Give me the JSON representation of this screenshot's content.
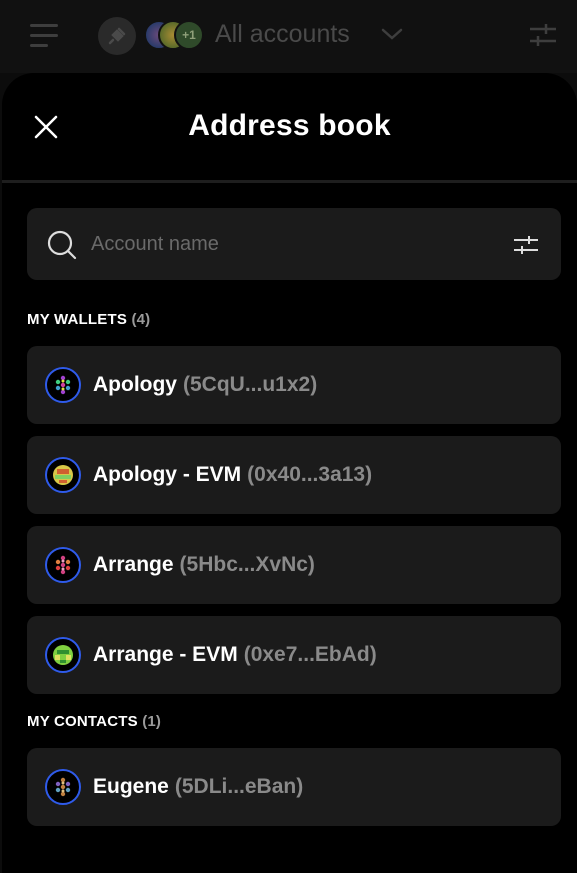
{
  "topbar": {
    "accounts_label": "All accounts",
    "avatar_more": "+1"
  },
  "modal": {
    "title": "Address book"
  },
  "search": {
    "placeholder": "Account name"
  },
  "my_wallets": {
    "title": "MY WALLETS",
    "count": "(4)",
    "items": [
      {
        "name": "Apology",
        "address": "(5CqU...u1x2)",
        "avatar_color": "#7a2fd0"
      },
      {
        "name": "Apology - EVM",
        "address": "(0x40...3a13)",
        "avatar_color": "#e0c040"
      },
      {
        "name": "Arrange",
        "address": "(5Hbc...XvNc)",
        "avatar_color": "#d04080"
      },
      {
        "name": "Arrange - EVM",
        "address": "(0xe7...EbAd)",
        "avatar_color": "#7ad040"
      }
    ]
  },
  "my_contacts": {
    "title": "MY CONTACTS",
    "count": "(1)",
    "items": [
      {
        "name": "Eugene",
        "address": "(5DLi...eBan)",
        "avatar_color": "#c08040"
      }
    ]
  },
  "colors": {
    "accent_border": "#2f5bea",
    "card_bg": "#1b1b1b",
    "modal_bg": "#000000"
  }
}
